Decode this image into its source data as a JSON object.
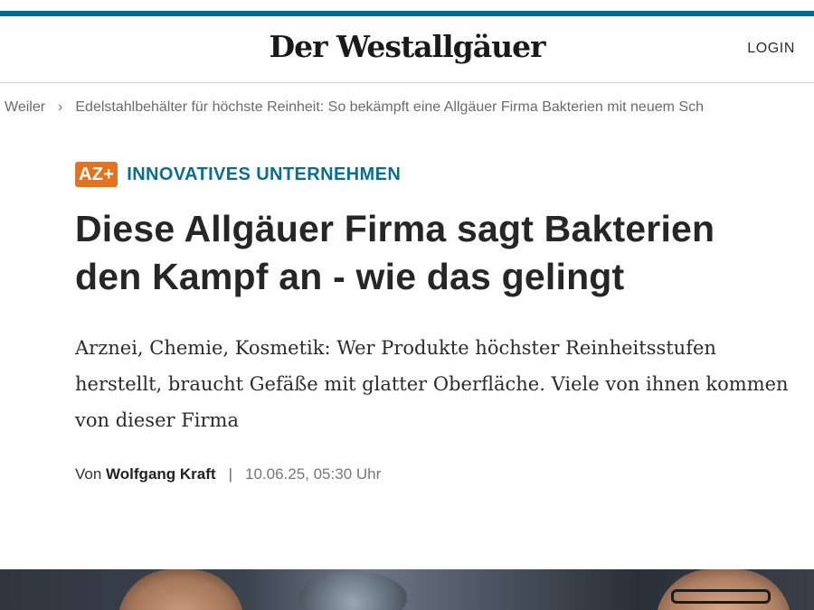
{
  "header": {
    "logo": "Der Westallgäuer",
    "login_label": "LOGIN"
  },
  "breadcrumb": {
    "items": [
      "Weiler",
      "Edelstahlbehälter für höchste Reinheit: So bekämpft eine Allgäuer Firma Bakterien mit neuem Sch"
    ]
  },
  "article": {
    "badge": "AZ+",
    "kicker": "INNOVATIVES UNTERNEHMEN",
    "headline_line1": "Diese Allgäuer Firma sagt Bakterien",
    "headline_line2": "den Kampf an - wie das gelingt",
    "teaser": "Arznei, Chemie, Kosmetik: Wer Produkte höchster Reinheitsstufen herstellt, braucht Gefäße mit glatter Oberfläche. Viele von ihnen kommen von dieser Firma",
    "byline_prefix": "Von",
    "author": "Wolfgang Kraft",
    "separator": "|",
    "date": "10.06.25, 05:30 Uhr"
  },
  "colors": {
    "accent": "#006a8c",
    "kicker": "#0a6e8e",
    "badge": "#e5731e"
  }
}
